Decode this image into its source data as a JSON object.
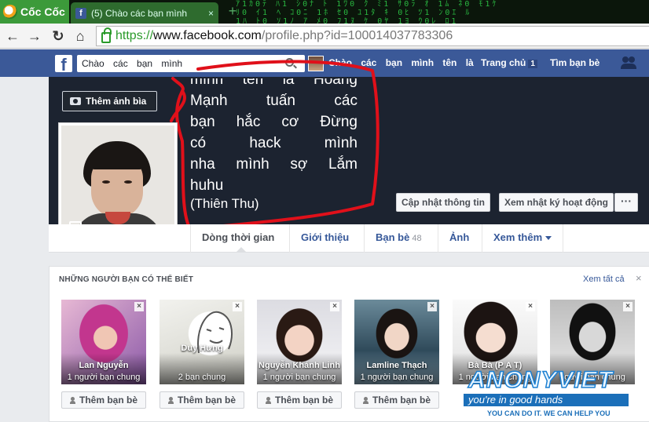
{
  "browser": {
    "brand_name": "Cốc Cốc",
    "tab_title": "(5) Chào các bạn mình",
    "tab_close": "×",
    "url_scheme": "https://",
    "url_host": "www.facebook.com",
    "url_path": "/profile.php?id=100014037783306"
  },
  "fb_header": {
    "search_text": "Chào các bạn mình",
    "user_name": "Chào các bạn mình tên là",
    "home_label": "Trang chủ",
    "home_count": "1",
    "find_friends_label": "Tìm bạn bè"
  },
  "cover": {
    "add_cover_label": "Thêm ảnh bìa",
    "bio_lines": [
      "Mạnh tuấn các",
      "bạn hắc cơ Đừng",
      "có hack mình",
      "nha mình sợ Lắm",
      "huhu"
    ],
    "bio_partial_top": "mình tên là Hoàng",
    "bio_signature": "(Thiên Thu)",
    "update_info_label": "Cập nhật thông tin",
    "activity_log_label": "Xem nhật ký hoạt động",
    "more_label": "···"
  },
  "profile_tabs": {
    "timeline": "Dòng thời gian",
    "about": "Giới thiệu",
    "friends": "Bạn bè",
    "friends_count": "48",
    "photos": "Ảnh",
    "more": "Xem thêm"
  },
  "pymk": {
    "title": "NHỮNG NGƯỜI BẠN CÓ THỂ BIẾT",
    "see_all": "Xem tất cả",
    "close": "×",
    "add_label": "Thêm bạn bè",
    "people": [
      {
        "name": "Lan Nguyễn",
        "mutual": "1 người bạn chung"
      },
      {
        "name": "Duy Hưng",
        "mutual": "2 bạn chung"
      },
      {
        "name": "Nguyễn Khánh Linh",
        "mutual": "1 người bạn chung"
      },
      {
        "name": "Lamline Thạch",
        "mutual": "1 người bạn chung"
      },
      {
        "name": "Bà Bà (P A T)",
        "mutual": "1 người bạn chung"
      },
      {
        "name": "",
        "mutual": "người bạn chung"
      }
    ]
  },
  "watermark": {
    "title": "ANONYVIET",
    "band": "you're in good hands",
    "sub": "YOU CAN DO IT. WE CAN HELP YOU"
  },
  "colors": {
    "fb_blue": "#3b5998",
    "link_blue": "#365899",
    "annotation_red": "#e0101a",
    "browser_green": "#3c9a3a"
  }
}
